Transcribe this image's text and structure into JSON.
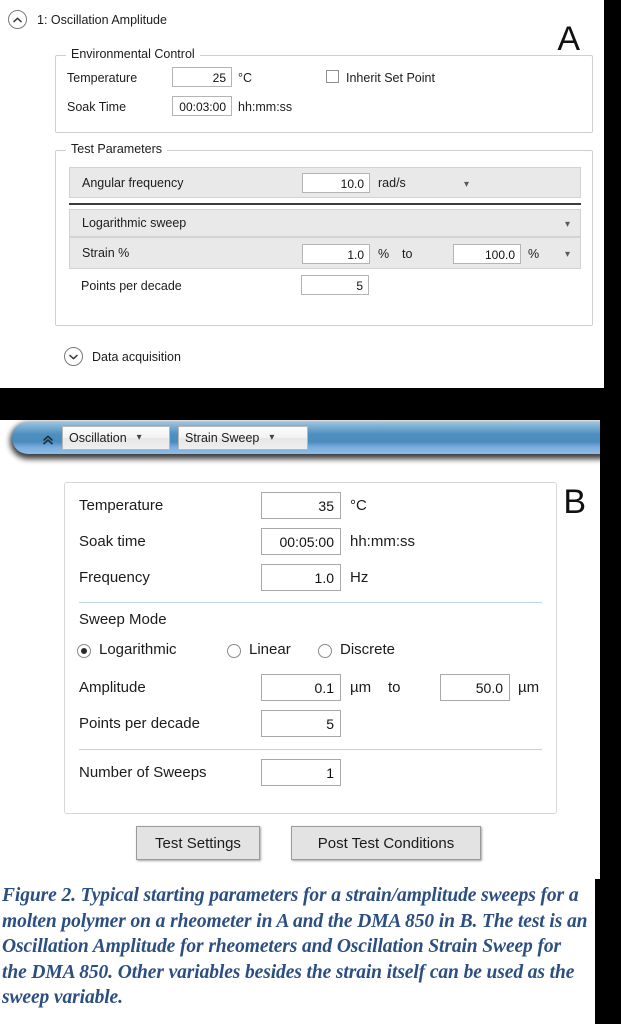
{
  "panel_a": {
    "letter": "A",
    "header": {
      "title": "1: Oscillation Amplitude",
      "collapse_icon": "chevron-up-circle-icon"
    },
    "environmental_control": {
      "legend": "Environmental Control",
      "temperature_label": "Temperature",
      "temperature_value": "25",
      "temperature_unit": "°C",
      "inherit_checkbox_label": "Inherit Set Point",
      "inherit_checked": false,
      "soak_time_label": "Soak Time",
      "soak_time_value": "00:03:00",
      "soak_time_unit": "hh:mm:ss"
    },
    "test_parameters": {
      "legend": "Test Parameters",
      "angular_frequency_label": "Angular frequency",
      "angular_frequency_value": "10.0",
      "angular_frequency_unit": "rad/s",
      "sweep_mode_value": "Logarithmic sweep",
      "strain_label": "Strain %",
      "strain_start_value": "1.0",
      "strain_start_unit": "%",
      "strain_to_label": "to",
      "strain_end_value": "100.0",
      "strain_end_unit": "%",
      "points_per_decade_label": "Points per decade",
      "points_per_decade_value": "5"
    },
    "data_acquisition": {
      "label": "Data acquisition",
      "expand_icon": "chevron-down-circle-icon"
    }
  },
  "panel_b": {
    "letter": "B",
    "tabbar": {
      "collapse_icon": "double-chevron-up-icon",
      "tabs": [
        {
          "label": "Oscillation",
          "caret": "chevron-down-icon"
        },
        {
          "label": "Strain Sweep",
          "caret": "chevron-down-icon"
        }
      ]
    },
    "form": {
      "temperature_label": "Temperature",
      "temperature_value": "35",
      "temperature_unit": "°C",
      "soak_time_label": "Soak time",
      "soak_time_value": "00:05:00",
      "soak_time_unit": "hh:mm:ss",
      "frequency_label": "Frequency",
      "frequency_value": "1.0",
      "frequency_unit": "Hz",
      "sweep_mode_label": "Sweep Mode",
      "sweep_modes": [
        {
          "label": "Logarithmic",
          "selected": true
        },
        {
          "label": "Linear",
          "selected": false
        },
        {
          "label": "Discrete",
          "selected": false
        }
      ],
      "amplitude_label": "Amplitude",
      "amplitude_start_value": "0.1",
      "amplitude_start_unit": "µm",
      "amplitude_to_label": "to",
      "amplitude_end_value": "50.0",
      "amplitude_end_unit": "µm",
      "points_per_decade_label": "Points per decade",
      "points_per_decade_value": "5",
      "number_of_sweeps_label": "Number of Sweeps",
      "number_of_sweeps_value": "1"
    },
    "buttons": {
      "test_settings": "Test Settings",
      "post_test_conditions": "Post Test Conditions"
    }
  },
  "caption": {
    "text": "Figure 2. Typical starting parameters for a strain/amplitude sweeps for a molten polymer on a rheometer in A and the DMA 850 in B. The test is an Oscillation Amplitude for rheometers and Oscillation Strain Sweep for the DMA 850. Other variables besides the strain itself can be used as the sweep variable."
  },
  "colors": {
    "caption_text": "#2b4f81",
    "tabbar_blue": "#4d8fbe",
    "row_gray": "#e9e9e9",
    "separator_blue": "#bdd2e8",
    "page_background": "#000000"
  }
}
